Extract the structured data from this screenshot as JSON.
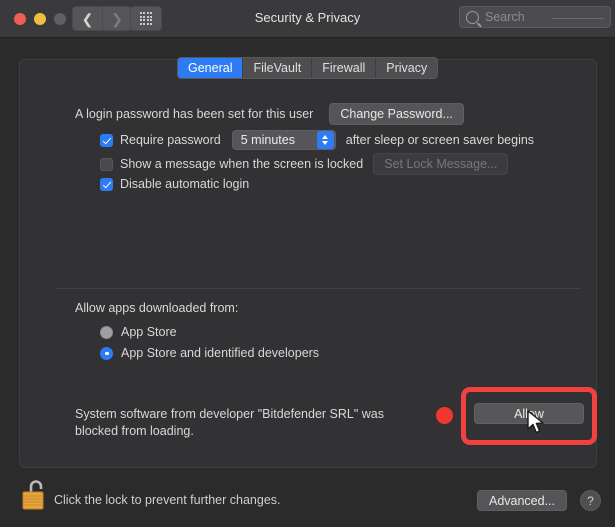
{
  "window": {
    "title": "Security & Privacy",
    "traffic_lights": [
      "close",
      "minimize",
      "zoom"
    ],
    "nav_back_icon": "chevron-left-icon",
    "nav_forward_icon": "chevron-right-icon",
    "show_all_icon": "grid-icon"
  },
  "search": {
    "placeholder": "Search",
    "value": "",
    "icon": "search-icon"
  },
  "tabs": [
    {
      "label": "General",
      "selected": true
    },
    {
      "label": "FileVault",
      "selected": false
    },
    {
      "label": "Firewall",
      "selected": false
    },
    {
      "label": "Privacy",
      "selected": false
    }
  ],
  "general": {
    "password_status": "A login password has been set for this user",
    "change_password_label": "Change Password...",
    "require_password": {
      "label": "Require password",
      "checked": true,
      "delay_value": "5 minutes",
      "suffix": "after sleep or screen saver begins"
    },
    "lock_message": {
      "label": "Show a message when the screen is locked",
      "checked": false,
      "button_label": "Set Lock Message...",
      "button_disabled": true
    },
    "disable_auto_login": {
      "label": "Disable automatic login",
      "checked": true
    }
  },
  "allow_apps": {
    "heading": "Allow apps downloaded from:",
    "options": [
      {
        "label": "App Store",
        "selected": false
      },
      {
        "label": "App Store and identified developers",
        "selected": true
      }
    ]
  },
  "blocked_software": {
    "message": "System software from developer \"Bitdefender SRL\" was blocked from loading.",
    "allow_button_label": "Allow"
  },
  "footer": {
    "lock_icon": "unlocked-padlock-icon",
    "lock_text": "Click the lock to prevent further changes.",
    "advanced_label": "Advanced...",
    "help_label": "?"
  },
  "annotations": {
    "marker_color": "#f1352f",
    "highlight_color": "#f0423e",
    "cursor_icon": "mouse-pointer-icon"
  }
}
